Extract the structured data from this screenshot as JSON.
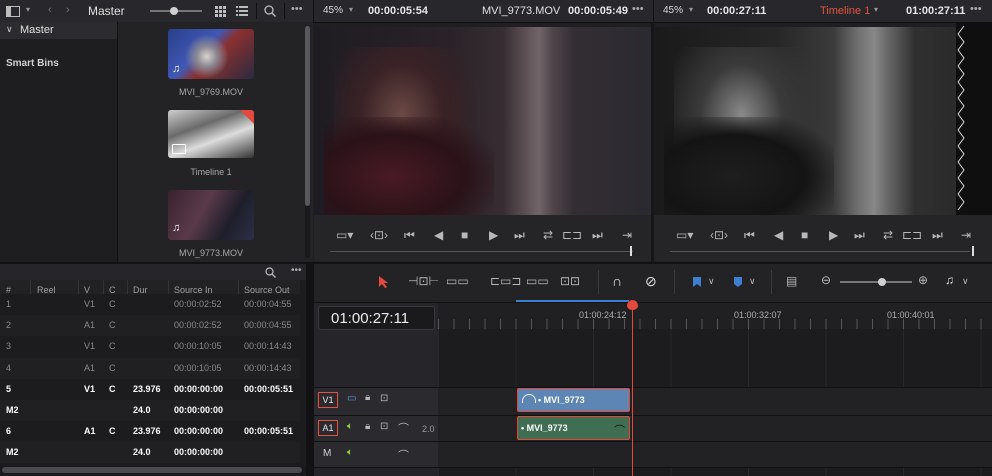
{
  "top_bar": {
    "bin_name": "Master",
    "more": "•••",
    "source_zoom": "45%",
    "source_timecode_left": "00:00:05:54",
    "source_clip": "MVI_9773.MOV",
    "source_timecode_right": "00:00:05:49",
    "program_zoom": "45%",
    "program_timecode_left": "00:00:27:11",
    "program_timeline": "Timeline 1",
    "program_timecode_right": "01:00:27:11"
  },
  "bins": {
    "master_label": "Master",
    "smart_bins_label": "Smart Bins"
  },
  "media_pool": {
    "clips": [
      {
        "name": "MVI_9769.MOV"
      },
      {
        "name": "Timeline 1"
      },
      {
        "name": "MVI_9773.MOV"
      }
    ]
  },
  "edit_index": {
    "headers": [
      "#",
      "Reel",
      "V",
      "C",
      "Dur",
      "Source In",
      "Source Out"
    ],
    "rows": [
      {
        "num": "1",
        "reel": "",
        "v": "V1",
        "c": "C",
        "dur": "",
        "src_in": "00:00:02:52",
        "src_out": "00:00:04:55",
        "style": "dim"
      },
      {
        "num": "2",
        "reel": "",
        "v": "A1",
        "c": "C",
        "dur": "",
        "src_in": "00:00:02:52",
        "src_out": "00:00:04:55",
        "style": "dim"
      },
      {
        "num": "3",
        "reel": "",
        "v": "V1",
        "c": "C",
        "dur": "",
        "src_in": "00:00:10:05",
        "src_out": "00:00:14:43",
        "style": "dim"
      },
      {
        "num": "4",
        "reel": "",
        "v": "A1",
        "c": "C",
        "dur": "",
        "src_in": "00:00:10:05",
        "src_out": "00:00:14:43",
        "style": "dim"
      },
      {
        "num": "5",
        "reel": "",
        "v": "V1",
        "c": "C",
        "dur": "23.976",
        "src_in": "00:00:00:00",
        "src_out": "00:00:05:51",
        "style": "bold"
      },
      {
        "num": "M2",
        "reel": "",
        "v": "",
        "c": "",
        "dur": "24.0",
        "src_in": "00:00:00:00",
        "src_out": "",
        "style": "bold"
      },
      {
        "num": "6",
        "reel": "",
        "v": "A1",
        "c": "C",
        "dur": "23.976",
        "src_in": "00:00:00:00",
        "src_out": "00:00:05:51",
        "style": "bold"
      },
      {
        "num": "M2",
        "reel": "",
        "v": "",
        "c": "",
        "dur": "24.0",
        "src_in": "00:00:00:00",
        "src_out": "",
        "style": "bold"
      }
    ]
  },
  "timeline": {
    "current_timecode": "01:00:27:11",
    "ruler": [
      "01:00:24:12",
      "01:00:32:07",
      "01:00:40:01"
    ],
    "tracks": {
      "v1_label": "V1",
      "a1_label": "A1",
      "a1_level": "2.0",
      "m_label": "M"
    },
    "clips": {
      "video": "• MVI_9773",
      "audio": "• MVI_9773"
    }
  },
  "colors": {
    "accent_red": "#e5483c",
    "video_clip": "#5d86b5",
    "audio_clip": "#3f6e52",
    "timeline_label_red": "#e0533d"
  }
}
